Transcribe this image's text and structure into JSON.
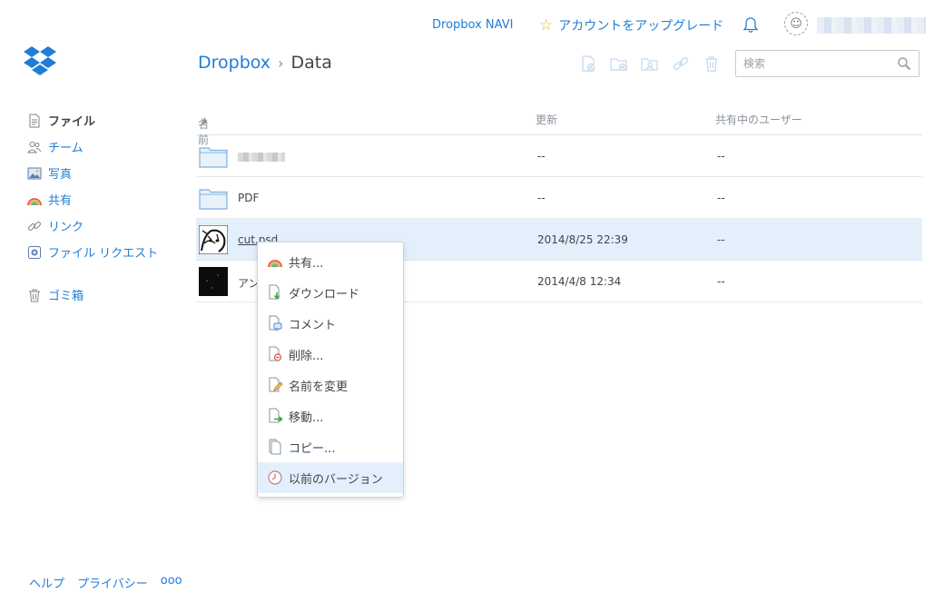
{
  "header": {
    "navi_label": "Dropbox NAVI",
    "upgrade_label": "アカウントをアップグレード"
  },
  "breadcrumb": {
    "root": "Dropbox",
    "current": "Data"
  },
  "search": {
    "placeholder": "検索"
  },
  "sidebar": {
    "items": [
      {
        "label": "ファイル",
        "icon": "file-icon",
        "active": true
      },
      {
        "label": "チーム",
        "icon": "team-icon"
      },
      {
        "label": "写真",
        "icon": "photo-icon"
      },
      {
        "label": "共有",
        "icon": "share-icon"
      },
      {
        "label": "リンク",
        "icon": "link-icon"
      },
      {
        "label": "ファイル リクエスト",
        "icon": "file-request-icon"
      }
    ],
    "trash": {
      "label": "ゴミ箱",
      "icon": "trash-icon"
    }
  },
  "footer": {
    "help": "ヘルプ",
    "privacy": "プライバシー",
    "more": "ooo"
  },
  "table": {
    "columns": {
      "name": "名前",
      "modified": "更新",
      "shared_with": "共有中のユーザー"
    },
    "rows": [
      {
        "name": "",
        "type": "folder",
        "modified": "--",
        "shared": "--",
        "name_obscured": true
      },
      {
        "name": "PDF",
        "type": "folder",
        "modified": "--",
        "shared": "--"
      },
      {
        "name": "cut.psd",
        "type": "image",
        "modified": "2014/8/25 22:39",
        "shared": "--",
        "selected": true
      },
      {
        "name": "アン",
        "type": "image-dark",
        "modified": "2014/4/8 12:34",
        "shared": "--"
      }
    ]
  },
  "context_menu": {
    "items": [
      {
        "label": "共有...",
        "icon": "share-rainbow-icon"
      },
      {
        "label": "ダウンロード",
        "icon": "download-icon"
      },
      {
        "label": "コメント",
        "icon": "comment-icon"
      },
      {
        "label": "削除...",
        "icon": "delete-icon"
      },
      {
        "label": "名前を変更",
        "icon": "rename-icon"
      },
      {
        "label": "移動...",
        "icon": "move-icon"
      },
      {
        "label": "コピー...",
        "icon": "copy-icon"
      },
      {
        "label": "以前のバージョン",
        "icon": "previous-version-icon",
        "hover": true
      }
    ]
  },
  "colors": {
    "accent": "#1f7dd6",
    "selected_row": "#e3f0fc",
    "text": "#3d464d"
  }
}
